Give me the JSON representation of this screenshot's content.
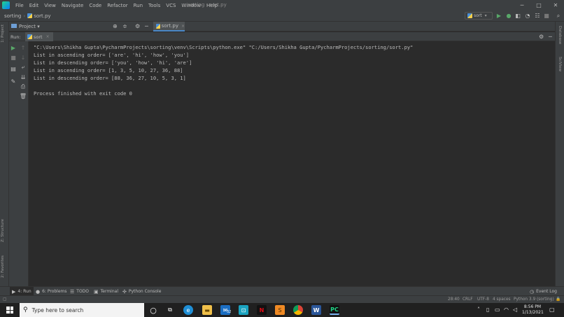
{
  "window": {
    "title": "sorting - sort.py",
    "menu": [
      "File",
      "Edit",
      "View",
      "Navigate",
      "Code",
      "Refactor",
      "Run",
      "Tools",
      "VCS",
      "Window",
      "Help"
    ],
    "controls": [
      "─",
      "□",
      "✕"
    ]
  },
  "navbar": {
    "project": "sorting",
    "file": "sort.py",
    "run_config": "sort"
  },
  "project_bar": {
    "label": "Project",
    "chevron": "▾"
  },
  "editor_tab": {
    "label": "sort.py",
    "close": "×"
  },
  "run_panel": {
    "label": "Run:",
    "tab": "sort",
    "close": "×",
    "console": [
      "\"C:\\Users\\Shikha Gupta\\PycharmProjects\\sorting\\venv\\Scripts\\python.exe\" \"C:/Users/Shikha Gupta/PycharmProjects/sorting/sort.py\"",
      "List in ascending order= ['are', 'hi', 'how', 'you']",
      "List in descending order= ['you', 'how', 'hi', 'are']",
      "List in ascending order= [1, 3, 5, 10, 27, 36, 88]",
      "List in descending order= [88, 36, 27, 10, 5, 3, 1]",
      "",
      "Process finished with exit code 0"
    ]
  },
  "side_labels": {
    "left_top": "1: Project",
    "left_structure": "Z: Structure",
    "left_favorites": "2: Favorites",
    "right_database": "Database",
    "right_sciview": "SciView"
  },
  "bottom_tabs": [
    {
      "label": "4: Run",
      "icon": "▶"
    },
    {
      "label": "6: Problems",
      "icon": "●"
    },
    {
      "label": "TODO",
      "icon": "☰"
    },
    {
      "label": "Terminal",
      "icon": "▣"
    },
    {
      "label": "Python Console",
      "icon": "✣"
    }
  ],
  "event_log": "Event Log",
  "status": {
    "position": "28:40",
    "line_sep": "CRLF",
    "encoding": "UTF-8",
    "indent": "4 spaces",
    "interpreter": "Python 3.9 (sorting)"
  },
  "taskbar": {
    "search_placeholder": "Type here to search",
    "time": "8:56 PM",
    "date": "1/13/2021",
    "mail_badge": "32"
  },
  "colors": {
    "ide_bg": "#2b2b2b",
    "panel_bg": "#3c3f41",
    "run_green": "#59a869",
    "accent_blue": "#4a88c7"
  }
}
